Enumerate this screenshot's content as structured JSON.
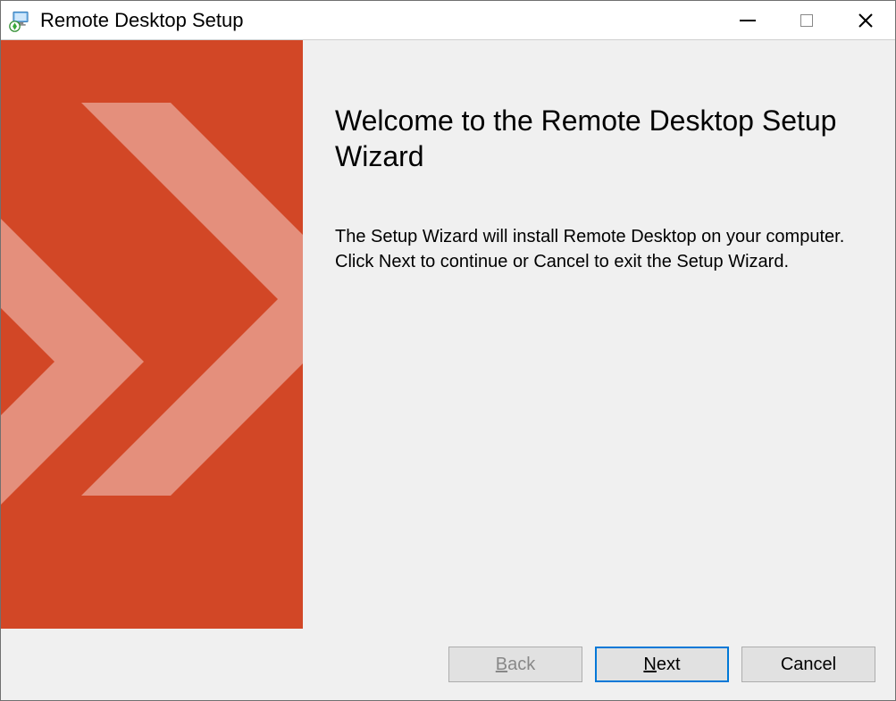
{
  "window": {
    "title": "Remote Desktop Setup"
  },
  "main": {
    "heading": "Welcome to the Remote Desktop Setup Wizard",
    "body": "The Setup Wizard will install Remote Desktop on your computer. Click Next to continue or Cancel to exit the Setup Wizard."
  },
  "footer": {
    "back": "Back",
    "next": "Next",
    "cancel": "Cancel"
  },
  "colors": {
    "banner": "#d24726",
    "banner_light": "#e48f7c",
    "primary_border": "#0078d7"
  }
}
